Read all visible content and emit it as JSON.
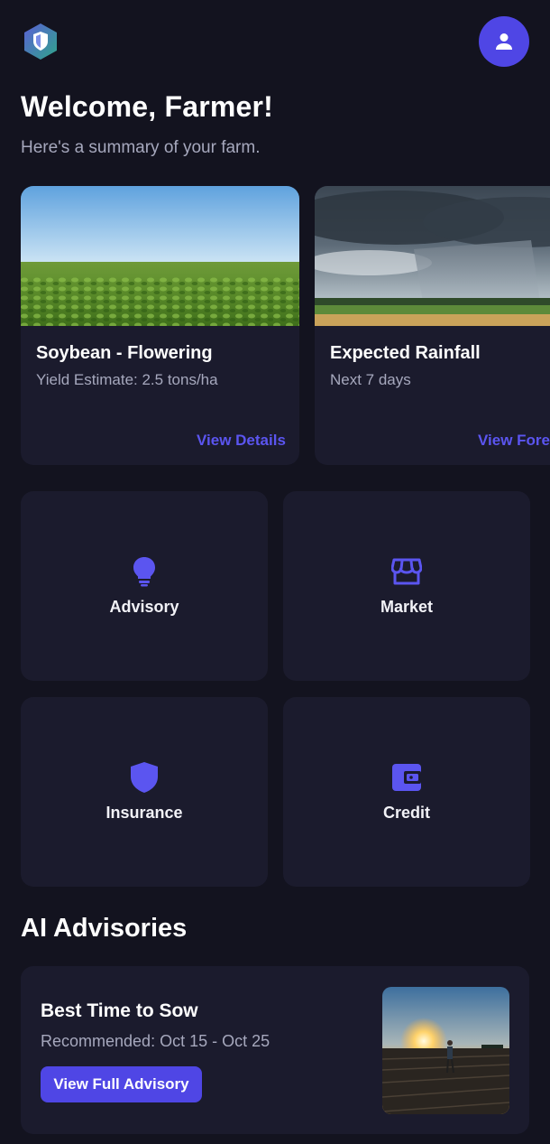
{
  "header": {
    "logo_icon": "shield-leaf-logo-icon",
    "profile_icon": "user-icon"
  },
  "welcome": {
    "title": "Welcome, Farmer!",
    "subtitle": "Here's a summary of your farm."
  },
  "cards": [
    {
      "image": "soybean-field-image",
      "title": "Soybean - Flowering",
      "meta": "Yield Estimate: 2.5 tons/ha",
      "link": "View Details"
    },
    {
      "image": "rain-storm-image",
      "title": "Expected Rainfall",
      "meta": "Next 7 days",
      "link": "View Forecast"
    }
  ],
  "tiles": [
    {
      "label": "Advisory",
      "icon": "lightbulb-icon"
    },
    {
      "label": "Market",
      "icon": "storefront-icon"
    },
    {
      "label": "Insurance",
      "icon": "shield-icon"
    },
    {
      "label": "Credit",
      "icon": "wallet-icon"
    }
  ],
  "ai_advisories": {
    "heading": "AI Advisories",
    "item": {
      "title": "Best Time to Sow",
      "meta": "Recommended: Oct 15 - Oct 25",
      "button": "View Full Advisory",
      "image": "sunset-field-farmer-image"
    }
  },
  "colors": {
    "background": "#13131f",
    "card": "#1b1b2d",
    "accent": "#4f46e5",
    "muted_text": "#a6a8bd"
  }
}
